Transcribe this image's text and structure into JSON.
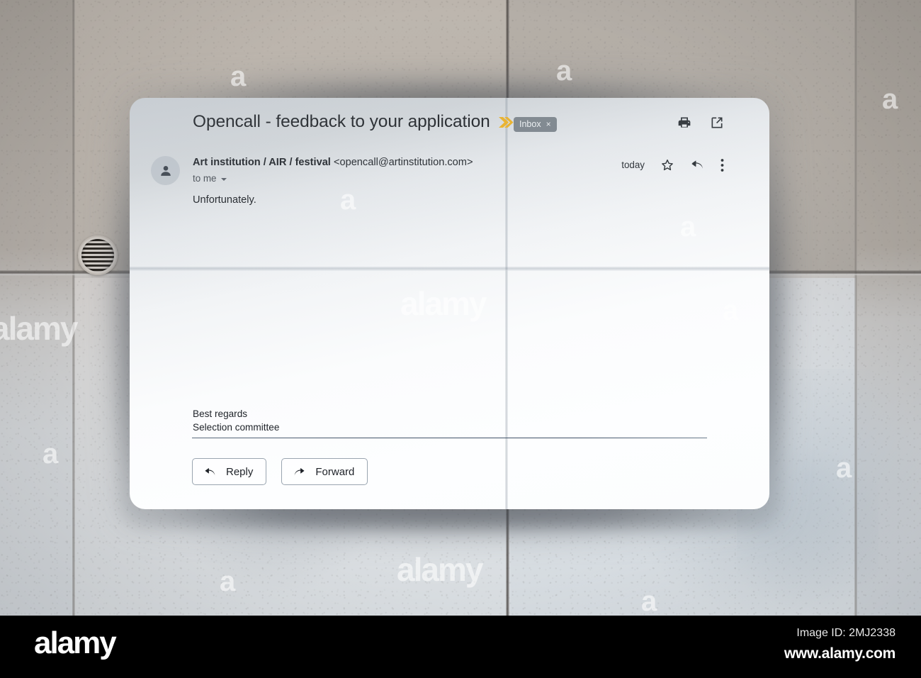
{
  "email": {
    "subject": "Opencall - feedback to your application",
    "importance_marker": "double-chevron-yellow",
    "label": {
      "name": "Inbox",
      "remove": "×"
    },
    "header_actions": [
      {
        "name": "print-icon",
        "label": "Print"
      },
      {
        "name": "open-in-new-window-icon",
        "label": "Open in new window"
      }
    ],
    "sender": {
      "name": "Art institution / AIR / festival",
      "address": "<opencall@artinstitution.com>",
      "recipients": "to me",
      "recipients_caret": "▾"
    },
    "date": "today",
    "message_actions": [
      {
        "name": "star-icon",
        "label": "Star"
      },
      {
        "name": "reply-arrow-icon",
        "label": "Reply"
      },
      {
        "name": "more-options-icon",
        "label": "More"
      }
    ],
    "body": "Unfortunately.",
    "signature": {
      "line1": "Best regards",
      "line2": "Selection committee"
    },
    "buttons": [
      {
        "name": "reply-button",
        "label": "Reply",
        "icon": "reply-arrow-icon"
      },
      {
        "name": "forward-button",
        "label": "Forward",
        "icon": "forward-arrow-icon"
      }
    ]
  },
  "scene": {
    "description": "Printed Gmail message pasted on a concrete wall with spray-painted dark halo",
    "vent": "round-wall-vent-icon"
  },
  "watermarks": {
    "letter": "a",
    "word": "alamy"
  },
  "footer": {
    "logo": "alamy",
    "image_id": "Image ID: 2MJ2338",
    "url": "www.alamy.com"
  },
  "colors": {
    "importance_yellow": "#f0b323",
    "label_chip_bg": "#7e868d",
    "card_white": "#fdfeff",
    "wall_warm": "#b6afa8",
    "wall_cool": "#dbe1e6",
    "spray_halo": "#3c4046",
    "text_dark": "#22262b",
    "divider_blue": "#44556a",
    "footer_black": "#000000"
  }
}
